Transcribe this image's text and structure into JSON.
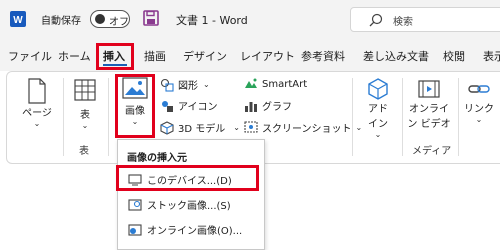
{
  "titlebar": {
    "app_icon": "word-logo-icon",
    "autosave_label": "自動保存",
    "autosave_state": "オフ",
    "doc_title": "文書 1  -  Word",
    "search_placeholder": "検索"
  },
  "tabs": [
    {
      "label": "ファイル"
    },
    {
      "label": "ホーム"
    },
    {
      "label": "挿入",
      "active": true
    },
    {
      "label": "描画"
    },
    {
      "label": "デザイン"
    },
    {
      "label": "レイアウト"
    },
    {
      "label": "参考資料"
    },
    {
      "label": "差し込み文書"
    },
    {
      "label": "校閲"
    },
    {
      "label": "表示"
    }
  ],
  "ribbon": {
    "page": {
      "label": "ページ",
      "chevron": "⌄"
    },
    "table": {
      "label": "表",
      "chevron": "⌄",
      "group": "表"
    },
    "image": {
      "label": "画像",
      "chevron": "⌄"
    },
    "shapes": {
      "label": "図形",
      "chevron": "⌄"
    },
    "icons": {
      "label": "アイコン"
    },
    "model3d": {
      "label": "3D モデル",
      "chevron": "⌄"
    },
    "smartart": {
      "label": "SmartArt"
    },
    "chart": {
      "label": "グラフ"
    },
    "screenshot": {
      "label": "スクリーンショット",
      "chevron": "⌄"
    },
    "addin": {
      "line1": "アド",
      "line2": "イン",
      "chevron": "⌄"
    },
    "online_video": {
      "line1": "オンライ",
      "line2": "ン ビデオ"
    },
    "link": {
      "label": "リンク",
      "chevron": "⌄"
    },
    "media_group": "メディア"
  },
  "dropdown": {
    "header": "画像の挿入元",
    "items": [
      {
        "label": "このデバイス...(D)"
      },
      {
        "label": "ストック画像...(S)"
      },
      {
        "label": "オンライン画像(O)..."
      }
    ]
  },
  "colors": {
    "highlight": "#e1001c",
    "word_blue": "#185abd",
    "save_purple": "#8a3a8f"
  }
}
